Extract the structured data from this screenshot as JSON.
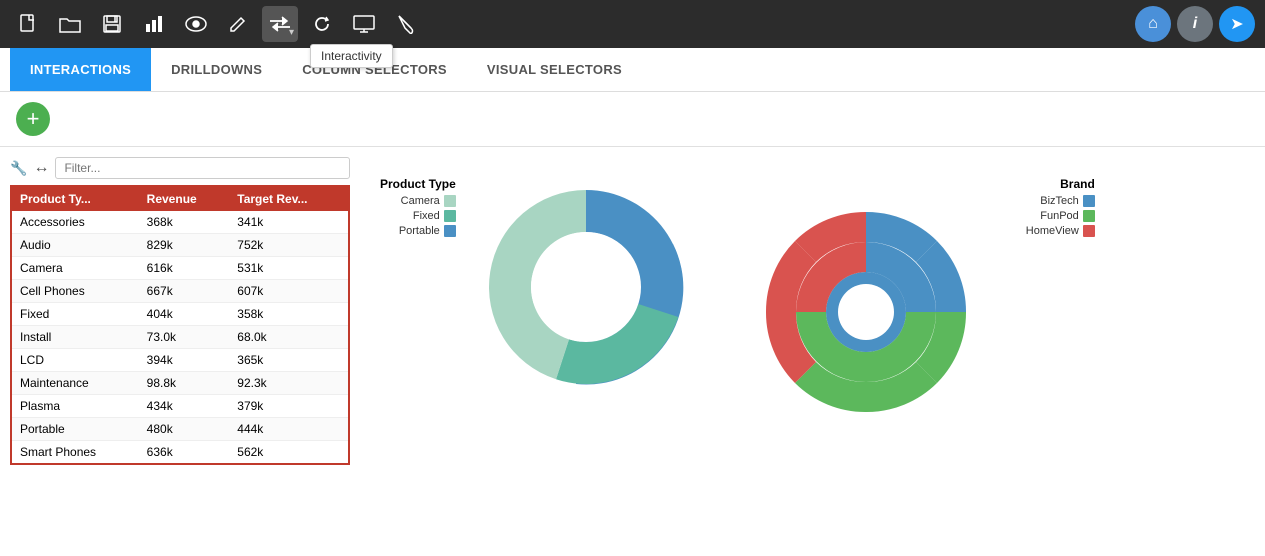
{
  "toolbar": {
    "icons": [
      {
        "name": "new-file-icon",
        "symbol": "⬜",
        "unicode": "📄"
      },
      {
        "name": "open-folder-icon",
        "symbol": "📁"
      },
      {
        "name": "save-icon",
        "symbol": "💾"
      },
      {
        "name": "bar-chart-icon",
        "symbol": "📊"
      },
      {
        "name": "eye-icon",
        "symbol": "👁"
      },
      {
        "name": "pencil-icon",
        "symbol": "✏"
      },
      {
        "name": "interactivity-icon",
        "symbol": "⇆"
      },
      {
        "name": "refresh-icon",
        "symbol": "↻"
      },
      {
        "name": "monitor-icon",
        "symbol": "🖥"
      },
      {
        "name": "brush-icon",
        "symbol": "🖌"
      }
    ],
    "right_icons": [
      {
        "name": "home-icon",
        "symbol": "⌂"
      },
      {
        "name": "info-icon",
        "symbol": "ℹ"
      },
      {
        "name": "share-icon",
        "symbol": "➤"
      }
    ]
  },
  "tooltip": {
    "text": "Interactivity"
  },
  "tabs": [
    {
      "label": "INTERACTIONS",
      "active": true
    },
    {
      "label": "DRILLDOWNS",
      "active": false
    },
    {
      "label": "COLUMN SELECTORS",
      "active": false
    },
    {
      "label": "VISUAL SELECTORS",
      "active": false
    }
  ],
  "add_button_label": "+",
  "filter_placeholder": "Filter...",
  "table": {
    "columns": [
      "Product Ty...",
      "Revenue",
      "Target Rev..."
    ],
    "rows": [
      [
        "Accessories",
        "368k",
        "341k"
      ],
      [
        "Audio",
        "829k",
        "752k"
      ],
      [
        "Camera",
        "616k",
        "531k"
      ],
      [
        "Cell Phones",
        "667k",
        "607k"
      ],
      [
        "Fixed",
        "404k",
        "358k"
      ],
      [
        "Install",
        "73.0k",
        "68.0k"
      ],
      [
        "LCD",
        "394k",
        "365k"
      ],
      [
        "Maintenance",
        "98.8k",
        "92.3k"
      ],
      [
        "Plasma",
        "434k",
        "379k"
      ],
      [
        "Portable",
        "480k",
        "444k"
      ],
      [
        "Smart Phones",
        "636k",
        "562k"
      ]
    ]
  },
  "chart1": {
    "legend_title": "Product Type",
    "legend": [
      {
        "label": "Camera",
        "color": "#a8d5c2"
      },
      {
        "label": "Fixed",
        "color": "#5bb8a0"
      },
      {
        "label": "Portable",
        "color": "#4a90c4"
      }
    ],
    "segments": [
      {
        "color": "#4a90c4",
        "startAngle": 0,
        "endAngle": 110
      },
      {
        "color": "#5bb8a0",
        "startAngle": 110,
        "endAngle": 200
      },
      {
        "color": "#a8d5c2",
        "startAngle": 200,
        "endAngle": 360
      }
    ]
  },
  "chart2": {
    "legend_title": "Brand",
    "legend": [
      {
        "label": "BizTech",
        "color": "#4a90c4"
      },
      {
        "label": "FunPod",
        "color": "#5cb85c"
      },
      {
        "label": "HomeView",
        "color": "#d9534f"
      }
    ]
  },
  "colors": {
    "tab_active_bg": "#2196F3",
    "table_header_bg": "#c0392b",
    "add_btn_bg": "#4CAF50",
    "toolbar_bg": "#2c2c2c"
  }
}
